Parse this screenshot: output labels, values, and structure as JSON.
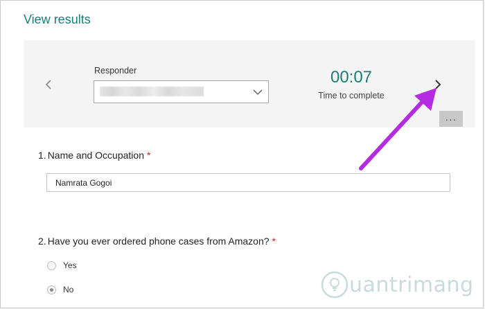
{
  "page": {
    "title": "View results"
  },
  "responder": {
    "label": "Responder",
    "prev_icon": "chevron-left-icon",
    "next_icon": "chevron-right-icon"
  },
  "timer": {
    "value": "00:07",
    "label": "Time to complete"
  },
  "more_button": {
    "label": "···"
  },
  "questions": [
    {
      "number": "1.",
      "title": "Name and Occupation",
      "required": "*",
      "answer": "Namrata Gogoi"
    },
    {
      "number": "2.",
      "title": "Have you ever ordered phone cases from Amazon?",
      "required": "*",
      "options": [
        {
          "label": "Yes",
          "selected": false
        },
        {
          "label": "No",
          "selected": true
        }
      ]
    }
  ],
  "watermark": {
    "text": "uantrimang"
  },
  "colors": {
    "accent": "#1b7d78",
    "required": "#c4262e",
    "annotation_arrow": "#b52ce0"
  }
}
